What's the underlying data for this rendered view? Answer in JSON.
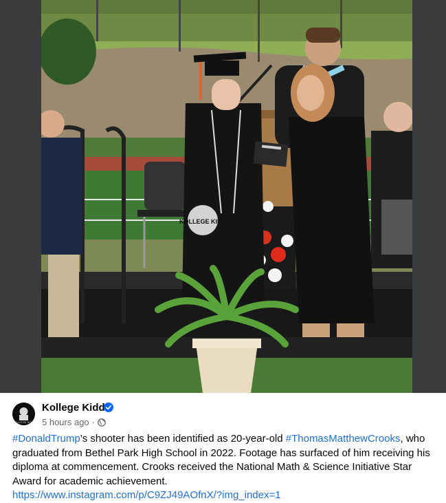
{
  "post": {
    "author": {
      "name": "Kollege Kidd",
      "avatar_text": "KOLLEGE KIDD",
      "verified": true
    },
    "timestamp": "5 hours ago",
    "separator": "·",
    "audience_icon": "globe-icon",
    "body": {
      "hashtag_1": "#DonaldTrump",
      "text_1": "’s shooter has been identified as 20-year-old ",
      "hashtag_2": "#ThomasMatthewCrooks",
      "text_2": ", who graduated from Bethel Park High School in 2022. Footage has surfaced of him receiving his diploma at commencement. Crooks received the National Math & Science Initiative Star Award for academic achievement.",
      "link": "https://www.instagram.com/p/C9ZJ49AOfnX/?img_index=1"
    },
    "media": {
      "watermark_text": "KOLLEGE KIDD"
    }
  },
  "colors": {
    "link": "#216fdb",
    "verified": "#0866ff",
    "secondary_text": "#65676b",
    "primary_text": "#050505"
  }
}
